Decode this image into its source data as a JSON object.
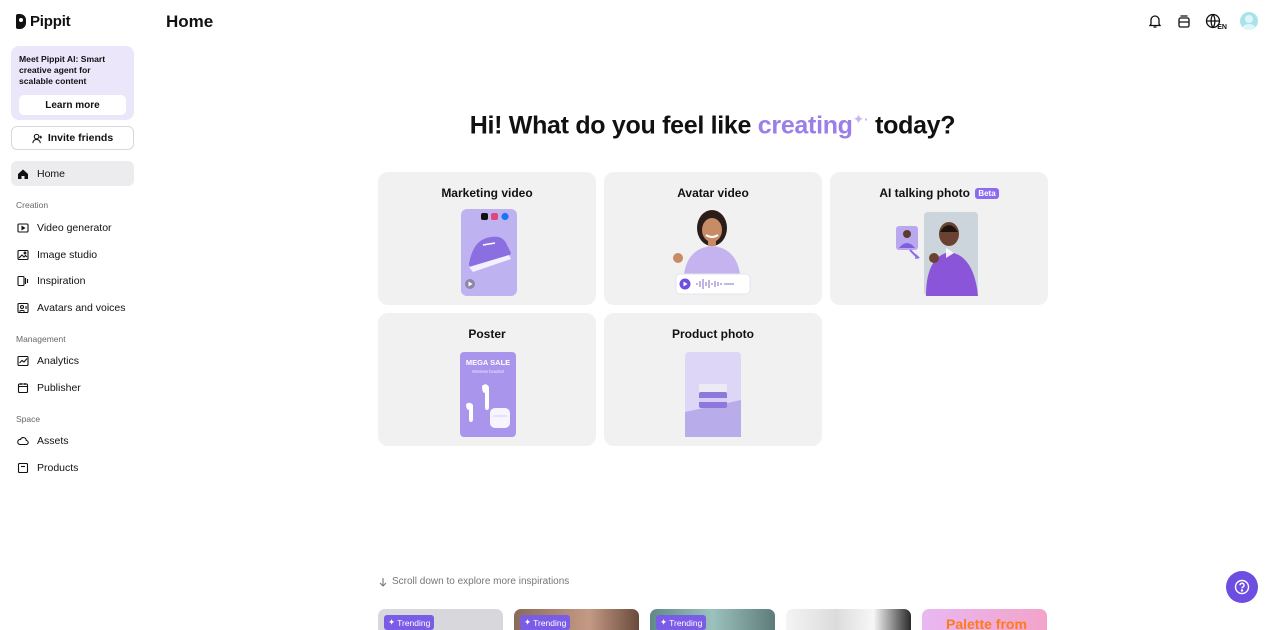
{
  "app": {
    "name": "Pippit"
  },
  "sidebar": {
    "promo": {
      "text": "Meet Pippit AI: Smart creative agent for scalable content",
      "button": "Learn more"
    },
    "invite_label": "Invite friends",
    "home_label": "Home",
    "sections": {
      "creation": "Creation",
      "management": "Management",
      "space": "Space"
    },
    "creation_items": [
      "Video generator",
      "Image studio",
      "Inspiration",
      "Avatars and voices"
    ],
    "management_items": [
      "Analytics",
      "Publisher"
    ],
    "space_items": [
      "Assets",
      "Products"
    ]
  },
  "header": {
    "title": "Home",
    "lang": "EN",
    "icons": [
      "bell-icon",
      "stack-icon",
      "globe-icon",
      "avatar"
    ]
  },
  "main": {
    "headline_pre": "Hi! What do you feel like",
    "headline_accent": "creating",
    "headline_post": "today?",
    "cards": [
      {
        "title": "Marketing video"
      },
      {
        "title": "Avatar video"
      },
      {
        "title": "AI talking photo",
        "badge": "Beta"
      },
      {
        "title": "Poster",
        "poster_line1": "MEGA SALE",
        "poster_line2": "Wireless headset"
      },
      {
        "title": "Product photo"
      }
    ],
    "scroll_hint": "Scroll down to explore more inspirations",
    "trending_label": "Trending",
    "thumb5_text": "Palette from"
  },
  "colors": {
    "accent": "#9b7fe8",
    "brand": "#6d4ee0",
    "card_bg": "#f1f1f2"
  }
}
